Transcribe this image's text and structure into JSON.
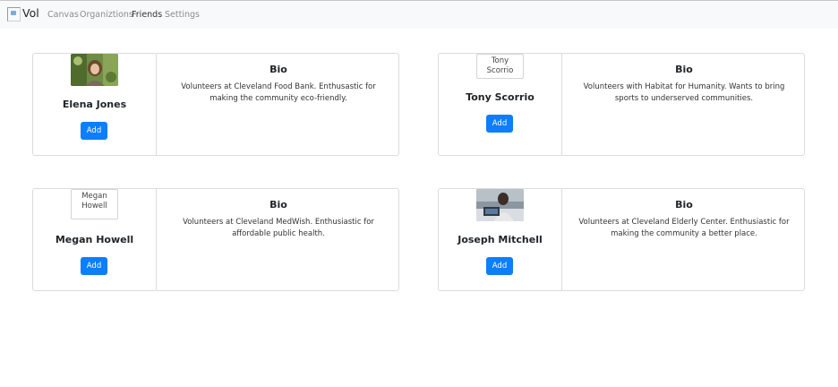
{
  "nav": {
    "brand": "Vol",
    "links": [
      "Canvas",
      "Organiztions",
      "Friends",
      "Settings"
    ],
    "active": "Friends"
  },
  "friends": [
    {
      "name": "Elena Jones",
      "photo_alt": "",
      "bio_title": "Bio",
      "bio": "Volunteers at Cleveland Food Bank. Enthusastic for making the community eco-friendly.",
      "add_label": "Add"
    },
    {
      "name": "Tony Scorrio",
      "photo_alt": "Tony Scorrio",
      "bio_title": "Bio",
      "bio": "Volunteers with Habitat for Humanity. Wants to bring sports to underserved communities.",
      "add_label": "Add"
    },
    {
      "name": "Megan Howell",
      "photo_alt": "Megan Howell",
      "bio_title": "Bio",
      "bio": "Volunteers at Cleveland MedWish. Enthusiastic for affordable public health.",
      "add_label": "Add"
    },
    {
      "name": "Joseph Mitchell",
      "photo_alt": "",
      "bio_title": "Bio",
      "bio": "Volunteers at Cleveland Elderly Center. Enthusiastic for making the community a better place.",
      "add_label": "Add"
    }
  ],
  "colors": {
    "primary_button": "#0d7efc",
    "navbar_bg": "#f8f9fa"
  }
}
